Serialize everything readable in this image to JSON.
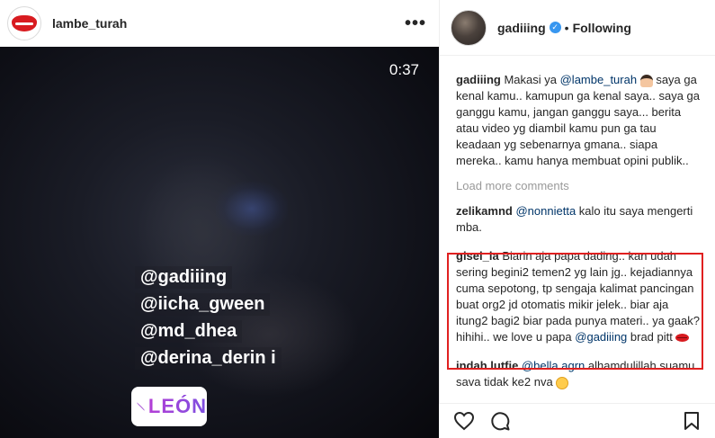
{
  "post": {
    "author": "lambe_turah",
    "more_label": "•••",
    "timer": "0:37",
    "tags": [
      "@gadiiing",
      "@iicha_gween",
      "@md_dhea",
      "@derina_derin i"
    ],
    "location": "LEÓN"
  },
  "sidebar": {
    "username": "gadiiing",
    "separator": "•",
    "follow_status": "Following"
  },
  "caption": {
    "user": "gadiiing",
    "pre": "Makasi ya ",
    "mention": "@lambe_turah",
    "text": "saya ga kenal kamu.. kamupun ga kenal saya.. saya ga ganggu kamu, jangan ganggu saya... berita atau video yg diambil kamu pun ga tau keadaan yg sebenarnya gmana.. siapa mereka.. kamu hanya membuat opini publik.."
  },
  "load_more": "Load more comments",
  "comments": [
    {
      "user": "zelikamnd",
      "mention": "@nonnietta",
      "text": " kalo itu saya mengerti mba."
    },
    {
      "user": "gisel_la",
      "text": "Biarin aja papa dading.. kan udah sering begini2 temen2 yg lain jg.. kejadiannya cuma sepotong, tp sengaja kalimat pancingan buat org2 jd otomatis mikir jelek.. biar aja itung2 bagi2 biar pada punya materi.. ya gaak?hihihi.. we love u papa ",
      "mention": "@gadiiing",
      "text_after": " brad pitt "
    },
    {
      "user": "indah.lutfie",
      "mention": "@bella.agrn",
      "text": " alhamdulillah suamu sava tidak ke2 nva "
    }
  ],
  "icons": {
    "like": "heart-icon",
    "comment": "comment-icon",
    "save": "bookmark-icon",
    "verified": "verified-badge-icon"
  },
  "colors": {
    "verified": "#3897f0",
    "highlight_border": "#e02020",
    "mention": "#003569"
  }
}
